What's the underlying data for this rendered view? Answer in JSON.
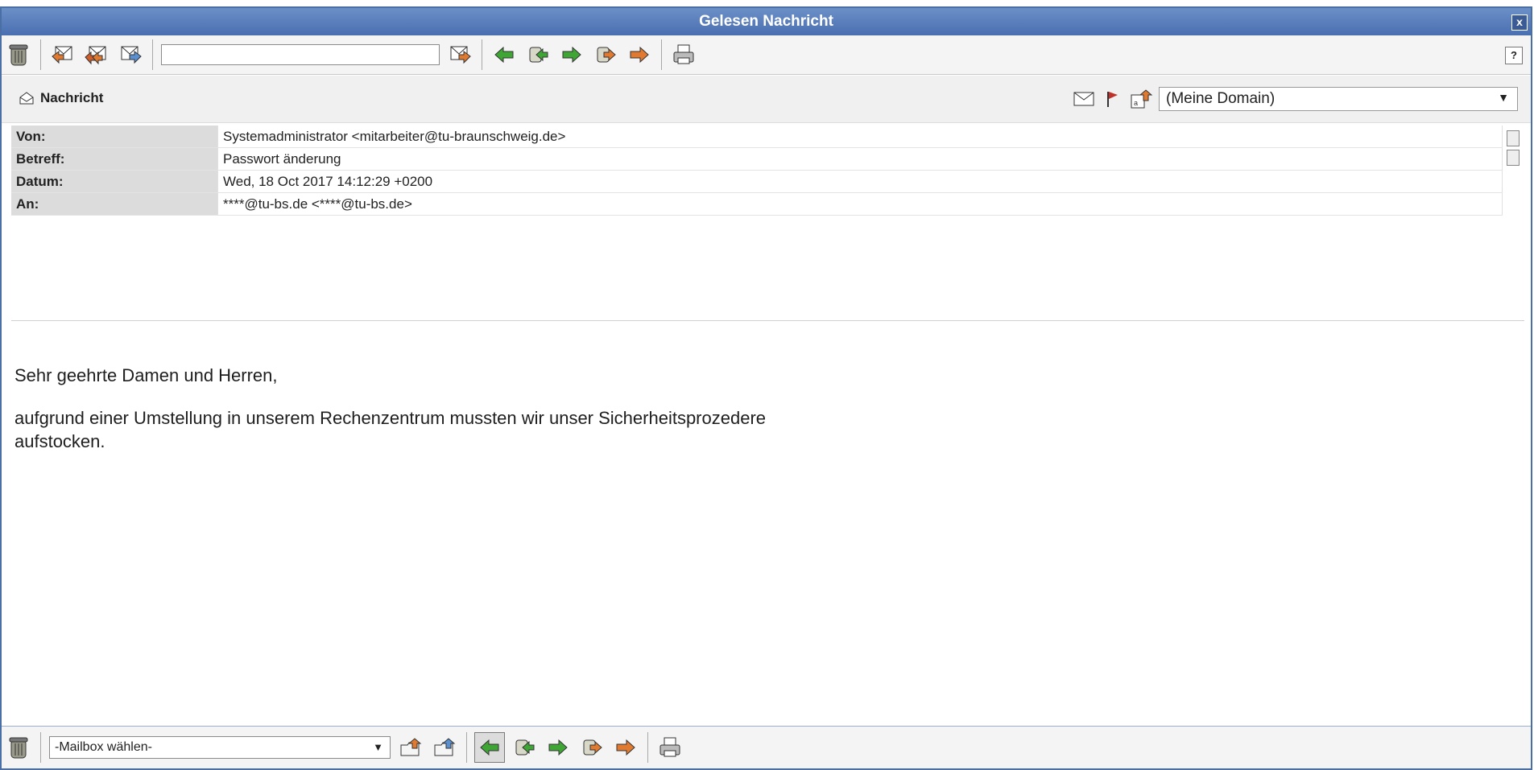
{
  "window": {
    "title": "Gelesen Nachricht",
    "close_label": "x"
  },
  "toolbar_top": {
    "help_label": "?",
    "icons": [
      "trash-icon",
      "reply-icon",
      "reply-all-icon",
      "forward-icon",
      "forward-to-icon",
      "prev-icon",
      "prev-thread-icon",
      "next-icon",
      "next-thread-icon",
      "next-unread-icon",
      "print-icon"
    ],
    "forward_input_value": ""
  },
  "message_header": {
    "title": "Nachricht",
    "domain_select": "(Meine Domain)"
  },
  "headers": [
    {
      "label": "Von:",
      "value": "Systemadministrator <mitarbeiter@tu-braunschweig.de>"
    },
    {
      "label": "Betreff:",
      "value": "Passwort änderung"
    },
    {
      "label": "Datum:",
      "value": "Wed, 18 Oct 2017 14:12:29 +0200"
    },
    {
      "label": "An:",
      "value": "****@tu-bs.de <****@tu-bs.de>"
    }
  ],
  "body": {
    "greeting": "Sehr geehrte Damen und Herren,",
    "line1": "aufgrund einer Umstellung in unserem Rechenzentrum mussten wir unser Sicherheitsprozedere",
    "line2": "aufstocken."
  },
  "toolbar_bottom": {
    "mailbox_select": "-Mailbox wählen-"
  },
  "colors": {
    "titlebar": "#4a6fb0",
    "label_bg": "#dcdcdc",
    "flag": "#c0302b"
  }
}
